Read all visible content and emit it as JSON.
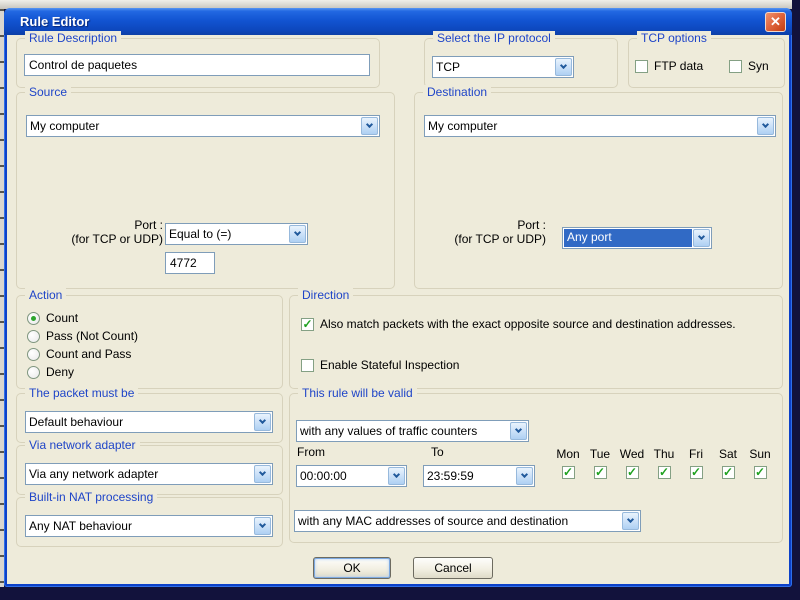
{
  "window": {
    "title": "Rule Editor"
  },
  "colors": {
    "titlebar_blue": "#1254d2",
    "frame_blue": "#0c41c9",
    "face": "#eeebda",
    "group_label_blue": "#1f45c8",
    "selection_blue": "#316ac5",
    "check_green": "#1fa11f",
    "close_red": "#d0481d"
  },
  "icons": {
    "close": "✕",
    "combo_arrow": "chevron-down"
  },
  "rule_description": {
    "label": "Rule Description",
    "value": "Control de paquetes"
  },
  "ip_protocol": {
    "label": "Select the IP protocol",
    "value": "TCP"
  },
  "tcp_options": {
    "label": "TCP options",
    "options": [
      {
        "label": "FTP data",
        "checked": false
      },
      {
        "label": "Syn",
        "checked": false
      }
    ]
  },
  "source": {
    "label": "Source",
    "address": "My computer",
    "port_label": "Port :",
    "port_sublabel": "(for TCP or UDP)",
    "port_condition": "Equal to (=)",
    "port_value": "4772"
  },
  "destination": {
    "label": "Destination",
    "address": "My computer",
    "port_label": "Port :",
    "port_sublabel": "(for TCP or UDP)",
    "port_condition": "Any port"
  },
  "action": {
    "label": "Action",
    "options": [
      {
        "label": "Count",
        "selected": true
      },
      {
        "label": "Pass (Not Count)",
        "selected": false
      },
      {
        "label": "Count and Pass",
        "selected": false
      },
      {
        "label": "Deny",
        "selected": false
      }
    ]
  },
  "direction": {
    "label": "Direction",
    "options": [
      {
        "label": "Also match packets with the exact opposite source and destination addresses.",
        "checked": true
      },
      {
        "label": "Enable Stateful Inspection",
        "checked": false
      }
    ]
  },
  "packet_must_be": {
    "label": "The packet must be",
    "value": "Default behaviour"
  },
  "via_adapter": {
    "label": "Via network adapter",
    "value": "Via any network adapter"
  },
  "nat": {
    "label": "Built-in NAT processing",
    "value": "Any NAT behaviour"
  },
  "validity": {
    "label": "This rule will be valid",
    "traffic_counters": "with any values of traffic counters",
    "from_label": "From",
    "to_label": "To",
    "from_value": "00:00:00",
    "to_value": "23:59:59",
    "days": [
      {
        "label": "Mon",
        "checked": true
      },
      {
        "label": "Tue",
        "checked": true
      },
      {
        "label": "Wed",
        "checked": true
      },
      {
        "label": "Thu",
        "checked": true
      },
      {
        "label": "Fri",
        "checked": true
      },
      {
        "label": "Sat",
        "checked": true
      },
      {
        "label": "Sun",
        "checked": true
      }
    ],
    "mac": "with any MAC addresses of source and destination"
  },
  "buttons": {
    "ok": "OK",
    "cancel": "Cancel"
  }
}
